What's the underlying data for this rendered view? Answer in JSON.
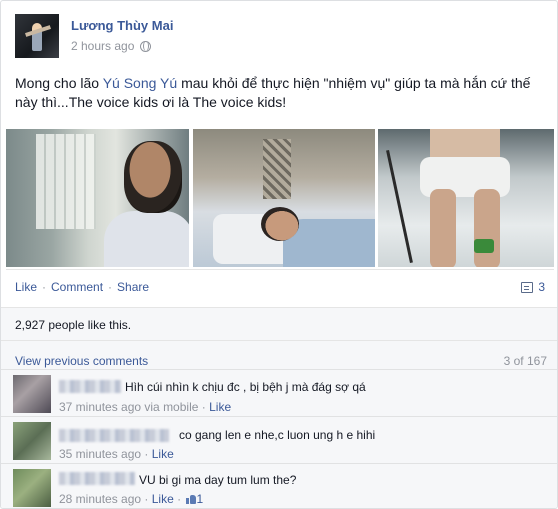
{
  "post": {
    "author": "Lương Thùy Mai",
    "timestamp": "2 hours ago",
    "privacy_icon": "globe-icon",
    "text_before_link": "Mong cho lão ",
    "text_link": "Yú Song Yú",
    "text_after_link": " mau khỏi để thực hiện \"nhiệm vụ\" giúp ta mà hắn cứ thế này thì...The voice kids ơi là The voice kids!",
    "photos": [
      "hospital-photo-1",
      "hospital-photo-2",
      "hospital-photo-3"
    ]
  },
  "actions": {
    "like": "Like",
    "sep1": "·",
    "comment": "Comment",
    "sep2": "·",
    "share": "Share",
    "share_count": "3",
    "share_icon": "share-icon"
  },
  "likes": {
    "text": "2,927 people like this."
  },
  "comments": {
    "view_previous": "View previous comments",
    "count": "3 of 167",
    "items": [
      {
        "text": "Hìh cúi nhìn k chịu đc , bị bệh j mà đág sợ qá",
        "time": "37 minutes ago via mobile",
        "sep": "·",
        "like": "Like",
        "like_count": ""
      },
      {
        "text": "co gang len e nhe,c luon ung h e hihi",
        "time": "35 minutes ago",
        "sep": "·",
        "like": "Like",
        "like_count": ""
      },
      {
        "text": "VU bi gi ma day tum lum the?",
        "time": "28 minutes ago",
        "sep": "·",
        "like": "Like",
        "sep2": "·",
        "like_count": "1"
      }
    ]
  },
  "colors": {
    "link": "#3b5998",
    "muted": "#90949c",
    "text": "#141823",
    "comments_bg": "#f6f7f9"
  }
}
